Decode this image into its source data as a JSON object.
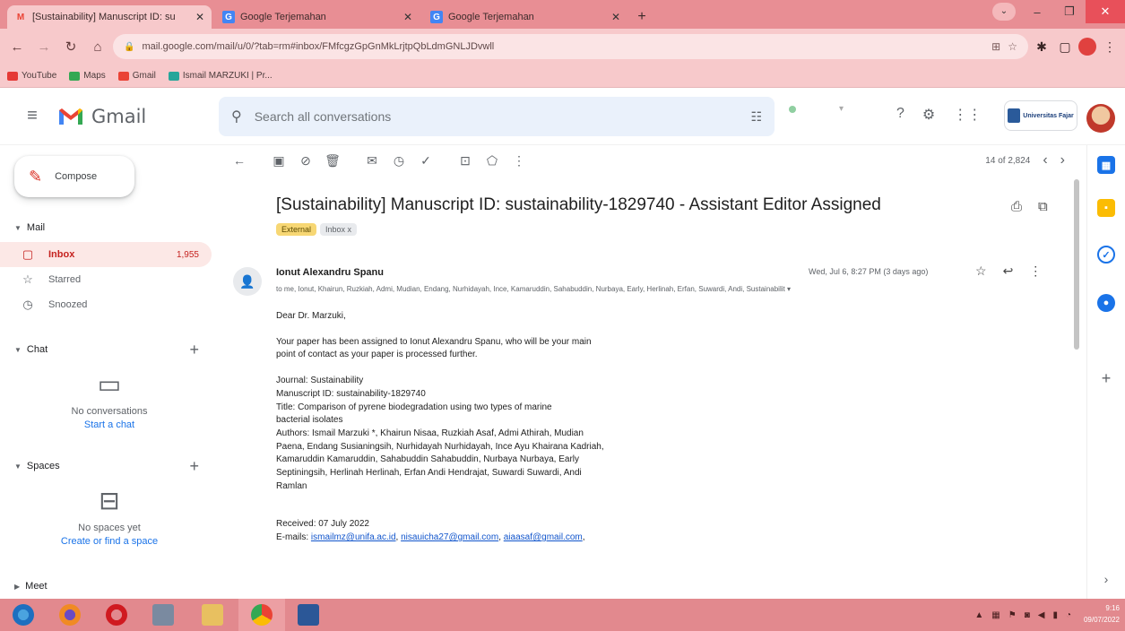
{
  "browser": {
    "tabs": [
      {
        "title": "[Sustainability] Manuscript ID: su",
        "active": true,
        "icon": "gmail-icon"
      },
      {
        "title": "Google Terjemahan",
        "active": false,
        "icon": "translate-icon"
      },
      {
        "title": "Google Terjemahan",
        "active": false,
        "icon": "translate-icon"
      }
    ],
    "new_tab": "+",
    "url": "mail.google.com/mail/u/0/?tab=rm#inbox/FMfcgzGpGnMkLrjtpQbLdmGNLJDvwll",
    "bookmarks": [
      {
        "label": "YouTube",
        "color": "#e53935"
      },
      {
        "label": "Maps",
        "color": "#34a853"
      },
      {
        "label": "Gmail",
        "color": "#ea4335"
      },
      {
        "label": "Ismail MARZUKI | Pr...",
        "color": "#26a69a"
      }
    ]
  },
  "gmail": {
    "app_name": "Gmail",
    "search_placeholder": "Search all conversations",
    "org_label": "Universitas Fajar"
  },
  "sidebar": {
    "compose_label": "Compose",
    "mail_header": "Mail",
    "items": [
      {
        "label": "Inbox",
        "count": "1,955",
        "icon": "inbox-icon"
      },
      {
        "label": "Starred",
        "count": "",
        "icon": "star-icon"
      },
      {
        "label": "Snoozed",
        "count": "",
        "icon": "clock-icon"
      }
    ],
    "chat_header": "Chat",
    "chat_empty": "No conversations",
    "chat_link": "Start a chat",
    "spaces_header": "Spaces",
    "spaces_empty": "No spaces yet",
    "spaces_link": "Create or find a space",
    "meet_header": "Meet"
  },
  "toolbar": {
    "pager_text": "14 of 2,824"
  },
  "message": {
    "subject": "[Sustainability] Manuscript ID: sustainability-1829740 - Assistant Editor Assigned",
    "label_external": "External",
    "label_inbox": "Inbox x",
    "sender": "Ionut Alexandru Spanu",
    "date": "Wed, Jul 6, 8:27 PM (3 days ago)",
    "to_line": "to me, Ionut, Khairun, Ruzkiah, Admi, Mudian, Endang, Nurhidayah, Ince, Kamaruddin, Sahabuddin, Nurbaya, Early, Herlinah, Erfan, Suwardi, Andi, Sustainabilit",
    "greeting": "Dear Dr. Marzuki,",
    "p1_line1": "Your paper has been assigned to Ionut Alexandru Spanu, who will be your main",
    "p1_line2": "point of contact as your paper is processed further.",
    "journal": "Journal: Sustainability",
    "manuscript_id": "Manuscript ID: sustainability-1829740",
    "title_line1": "Title: Comparison of pyrene biodegradation using two types of marine",
    "title_line2": "bacterial isolates",
    "authors_line1": "Authors: Ismail Marzuki *, Khairun Nisaa, Ruzkiah Asaf, Admi Athirah, Mudian",
    "authors_line2": "Paena, Endang Susianingsih, Nurhidayah Nurhidayah, Ince Ayu Khairana Kadriah,",
    "authors_line3": "Kamaruddin Kamaruddin, Sahabuddin Sahabuddin, Nurbaya Nurbaya, Early",
    "authors_line4": "Septiningsih, Herlinah Herlinah, Erfan Andi Hendrajat, Suwardi Suwardi, Andi",
    "authors_line5": "Ramlan",
    "received": "Received: 07 July 2022",
    "emails_label": "E-mails:",
    "emails": [
      "ismailmz@unifa.ac.id",
      "nisauicha27@gmail.com",
      "aiaasaf@gmail.com"
    ]
  },
  "taskbar": {
    "time": "9:16",
    "date": "09/07/2022"
  }
}
